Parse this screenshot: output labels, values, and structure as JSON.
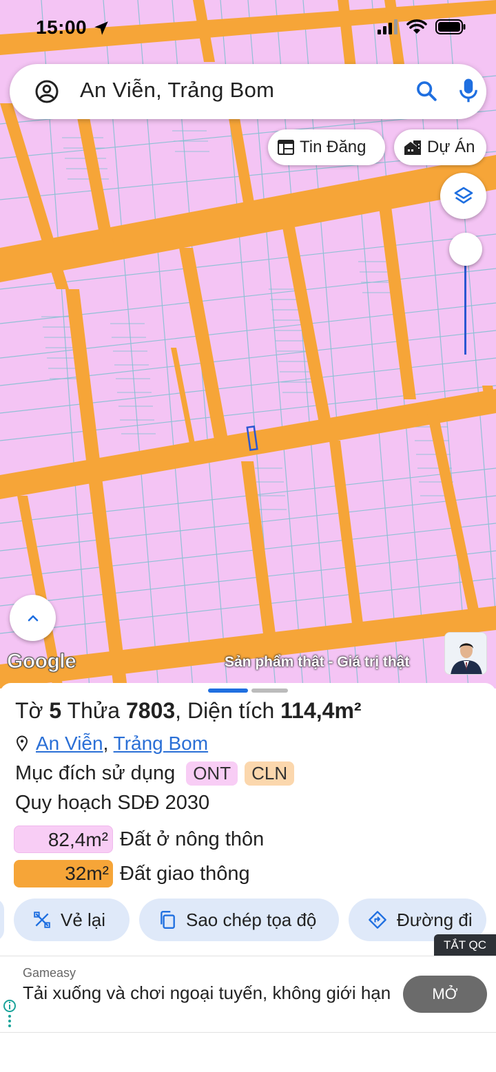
{
  "status_bar": {
    "time": "15:00"
  },
  "search": {
    "text": "An Viễn, Trảng Bom"
  },
  "chips": {
    "tin_dang": "Tin Đăng",
    "du_an": "Dự Án"
  },
  "map": {
    "watermark": "Google",
    "promo": "Sản phẩm thật - Giá trị thật"
  },
  "parcel": {
    "to_label": "Tờ",
    "to_value": "5",
    "thua_label": "Thửa",
    "thua_value": "7803",
    "dien_tich_label": "Diện tích",
    "dien_tich_value": "114,4m²",
    "commune": "An Viễn",
    "district": "Trảng Bom",
    "purpose_label": "Mục đích sử dụng",
    "purpose_tags": [
      "ONT",
      "CLN"
    ],
    "plan_label": "Quy hoạch SDĐ 2030",
    "areas": [
      {
        "value": "82,4m²",
        "label": "Đất ở nông thôn",
        "color": "#f8cdf5"
      },
      {
        "value": "32m²",
        "label": "Đất giao thông",
        "color": "#f6a538"
      }
    ]
  },
  "actions": {
    "redraw": "Vẻ lại",
    "copy_coords": "Sao chép tọa độ",
    "directions": "Đường đi"
  },
  "ad": {
    "badge": "TẮT QC",
    "sponsor": "Gameasy",
    "text": "Tải xuống và chơi ngoại tuyến, không giới hạn",
    "button": "MỞ"
  },
  "colors": {
    "land": "#f4c4f4",
    "road": "#f6a538",
    "parcel_lines": "#6fb7c8",
    "accent": "#2a6fd6"
  }
}
